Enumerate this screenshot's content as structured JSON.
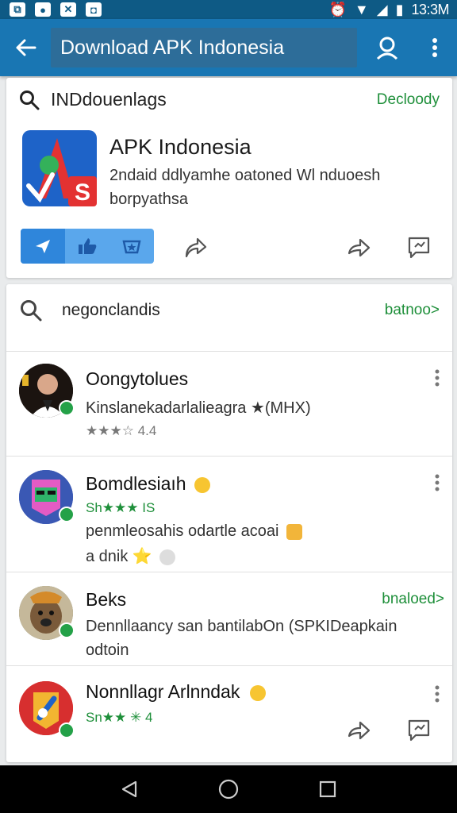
{
  "status_bar": {
    "time": "13:3M"
  },
  "app_bar": {
    "search_text": "Download APK Indonesia"
  },
  "top_card": {
    "query": "INDdouenlags",
    "action": "Decloody",
    "app_title": "APK Indonesia",
    "app_desc": "2ndaid ddlyamhe oatoned Wl nduoesh borpyathsa"
  },
  "results": {
    "query": "negonclandis",
    "action": "batnoo>",
    "items": [
      {
        "title": "Oongytolues",
        "line1": "Kinslanekadarlalieagra ★(MHX)",
        "rating_stars": "★★★☆",
        "rating_text": "4.4"
      },
      {
        "title": "Bomdlesiaıh",
        "rating_label": "Sh★★★ IS",
        "line1": "penmleosahis odartle acoai",
        "line2": "a dnik ⭐"
      },
      {
        "title": "Beks",
        "action": "bnaloed>",
        "line1": "Dennllaancy san bantilabOn (SPKIDeapkain",
        "line2": "odtoin"
      },
      {
        "title": "Nonnllagr Arlnndak",
        "rating_label": "Sn★★ ✳ 4"
      }
    ]
  },
  "colors": {
    "primary": "#1976b3",
    "status": "#0e5a85",
    "accent_green": "#1e8f3a",
    "reaction_blue": "#5aa7ec"
  },
  "icons": [
    "arrow-back-icon",
    "account-search-icon",
    "more-vert-icon",
    "search-icon",
    "send-icon",
    "thumb-up-icon",
    "star-badge-icon",
    "share-icon",
    "forward-icon",
    "feedback-icon",
    "back-triangle-icon",
    "home-circle-icon",
    "recents-square-icon"
  ]
}
